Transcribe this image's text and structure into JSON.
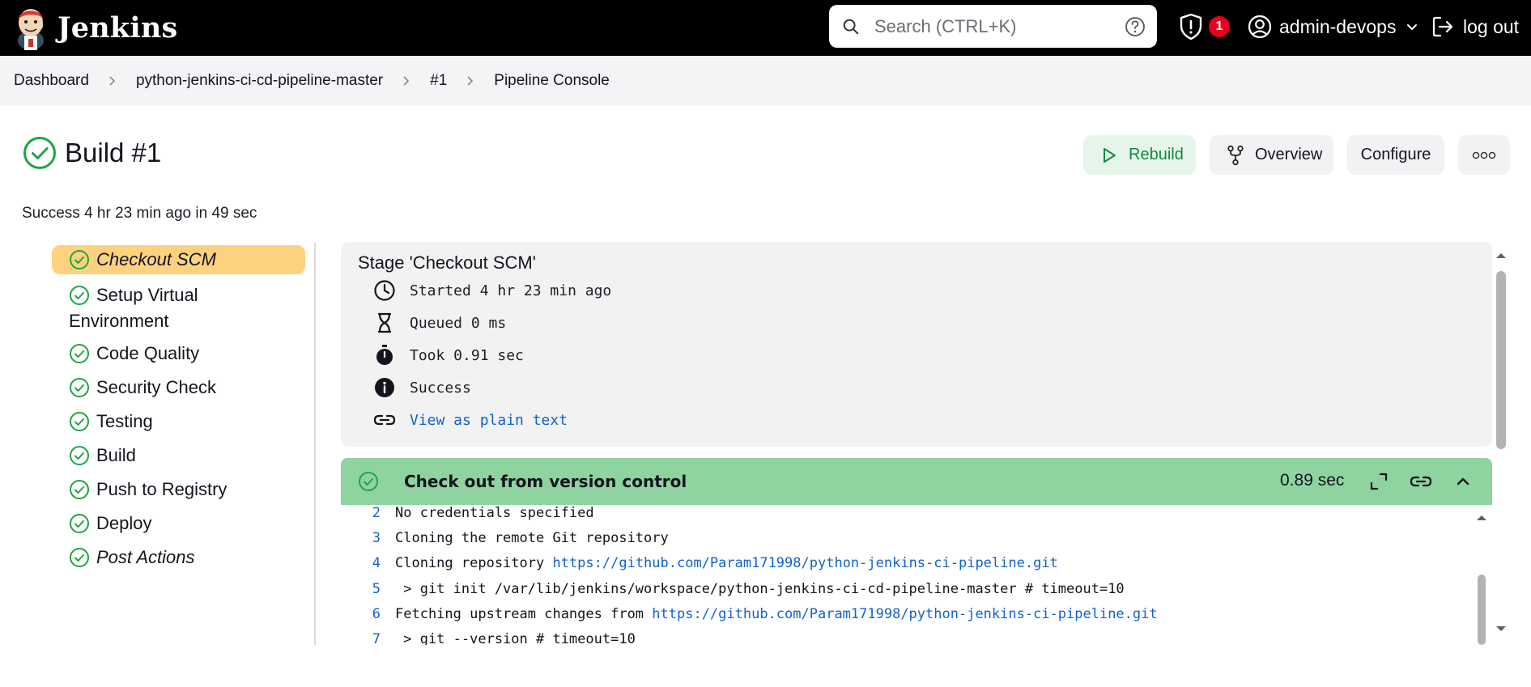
{
  "app": {
    "name": "Jenkins"
  },
  "search": {
    "placeholder": "Search (CTRL+K)"
  },
  "notifications": {
    "count": "1"
  },
  "user": {
    "name": "admin-devops"
  },
  "logout": {
    "label": "log out"
  },
  "breadcrumb": [
    "Dashboard",
    "python-jenkins-ci-cd-pipeline-master",
    "#1",
    "Pipeline Console"
  ],
  "build": {
    "title": "Build #1",
    "status_line": "Success 4 hr 23 min ago in 49 sec"
  },
  "actions": {
    "rebuild": "Rebuild",
    "overview": "Overview",
    "configure": "Configure"
  },
  "stages": [
    {
      "label": "Checkout SCM",
      "status": "success"
    },
    {
      "label_line1": "Setup Virtual",
      "label_line2": "Environment",
      "status": "success"
    },
    {
      "label": "Code Quality",
      "status": "success"
    },
    {
      "label": "Security Check",
      "status": "success"
    },
    {
      "label": "Testing",
      "status": "success"
    },
    {
      "label": "Build",
      "status": "success"
    },
    {
      "label": "Push to Registry",
      "status": "success"
    },
    {
      "label": "Deploy",
      "status": "success"
    },
    {
      "label": "Post Actions",
      "status": "success"
    }
  ],
  "stage_detail": {
    "title": "Stage 'Checkout SCM'",
    "started": "Started 4 hr 23 min ago",
    "queued": "Queued 0 ms",
    "took": "Took 0.91 sec",
    "result": "Success",
    "plain_text_link": "View as plain text"
  },
  "step": {
    "title": "Check out from version control",
    "duration": "0.89 sec"
  },
  "log": [
    {
      "n": "2",
      "text": "No credentials specified"
    },
    {
      "n": "3",
      "text": "Cloning the remote Git repository"
    },
    {
      "n": "4",
      "text": "Cloning repository ",
      "link": "https://github.com/Param171998/python-jenkins-ci-pipeline.git"
    },
    {
      "n": "5",
      "text": " > git init /var/lib/jenkins/workspace/python-jenkins-ci-cd-pipeline-master # timeout=10"
    },
    {
      "n": "6",
      "text": "Fetching upstream changes from ",
      "link": "https://github.com/Param171998/python-jenkins-ci-pipeline.git"
    },
    {
      "n": "7",
      "text": " > git --version # timeout=10"
    }
  ],
  "colors": {
    "topbar": "#000000",
    "success": "#1ea446",
    "active_stage": "#fcd27f",
    "step_header": "#8fd3a1",
    "link": "#1162cc",
    "badge": "#e6001f"
  }
}
